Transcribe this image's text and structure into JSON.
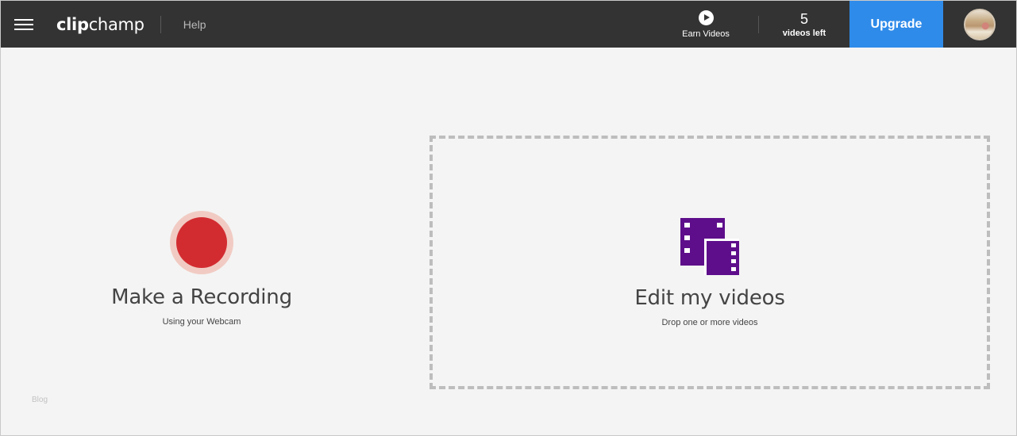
{
  "header": {
    "logo_bold": "clip",
    "logo_light": "champ",
    "help_label": "Help",
    "earn_label": "Earn Videos",
    "videos_count": "5",
    "videos_label": "videos left",
    "upgrade_label": "Upgrade"
  },
  "record": {
    "title": "Make a Recording",
    "subtitle": "Using your Webcam"
  },
  "edit": {
    "title": "Edit my videos",
    "subtitle": "Drop one or more videos"
  },
  "footer": {
    "blog_label": "Blog"
  },
  "colors": {
    "header_bg": "#333333",
    "accent": "#2f8be9",
    "record_red": "#d22c31",
    "film_purple": "#5e0e8b",
    "page_bg": "#f4f4f4"
  },
  "icons": [
    "menu-icon",
    "play-icon",
    "record-icon",
    "film-icon",
    "avatar"
  ]
}
